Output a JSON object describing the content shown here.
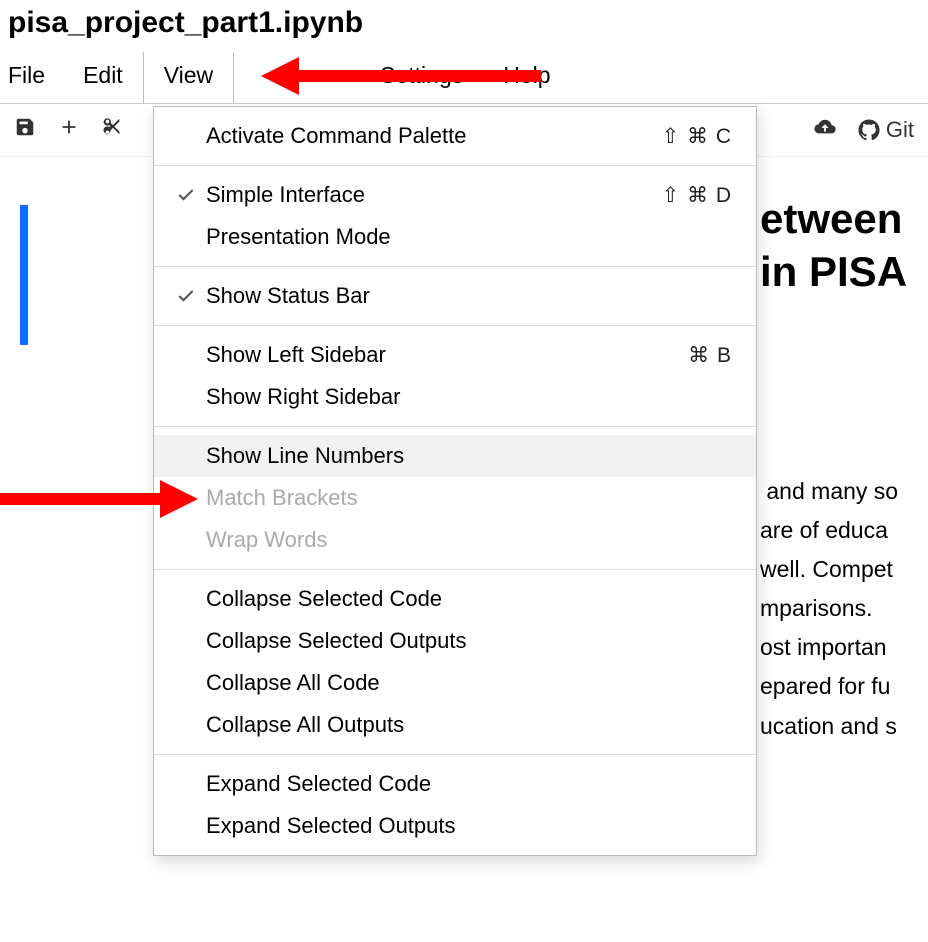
{
  "title": "pisa_project_part1.ipynb",
  "menubar": {
    "file": "File",
    "edit": "Edit",
    "view": "View",
    "settings": "Settings",
    "help": "Help"
  },
  "toolbar": {
    "git_label": "Git"
  },
  "dropdown": {
    "activate_palette": {
      "label": "Activate Command Palette",
      "shortcut": "⇧ ⌘ C"
    },
    "simple_interface": {
      "label": "Simple Interface",
      "shortcut": "⇧ ⌘ D"
    },
    "presentation_mode": {
      "label": "Presentation Mode"
    },
    "show_status_bar": {
      "label": "Show Status Bar"
    },
    "show_left_sidebar": {
      "label": "Show Left Sidebar",
      "shortcut": "⌘ B"
    },
    "show_right_sidebar": {
      "label": "Show Right Sidebar"
    },
    "show_line_numbers": {
      "label": "Show Line Numbers"
    },
    "match_brackets": {
      "label": "Match Brackets"
    },
    "wrap_words": {
      "label": "Wrap Words"
    },
    "collapse_sel_code": {
      "label": "Collapse Selected Code"
    },
    "collapse_sel_outputs": {
      "label": "Collapse Selected Outputs"
    },
    "collapse_all_code": {
      "label": "Collapse All Code"
    },
    "collapse_all_outputs": {
      "label": "Collapse All Outputs"
    },
    "expand_sel_code": {
      "label": "Expand Selected Code"
    },
    "expand_sel_outputs": {
      "label": "Expand Selected Outputs"
    }
  },
  "content": {
    "heading_fragment": "etween\nin PISA",
    "body_fragment": " and many so\nare of educa\nwell. Compet\nmparisons.\nost importan\nepared for fu\nucation and s"
  }
}
